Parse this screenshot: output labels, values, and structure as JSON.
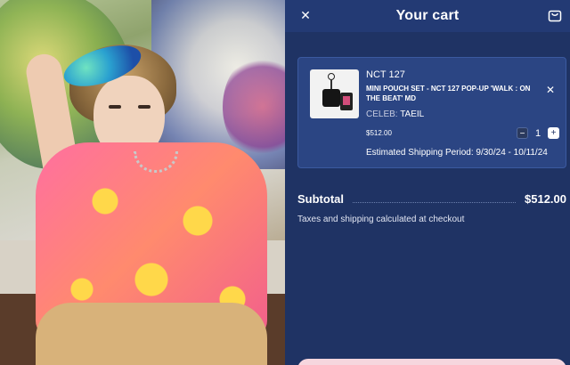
{
  "cart": {
    "title": "Your cart",
    "close_icon": "close-icon",
    "bag_icon": "shopping-bag-icon",
    "items": [
      {
        "group": "NCT 127",
        "name": "MINI POUCH SET - NCT 127 POP-UP 'WALK : ON THE BEAT' MD",
        "option_label": "CELEB:",
        "option_value": "TAEIL",
        "price": "$512.00",
        "quantity": "1",
        "shipping": "Estimated Shipping Period: 9/30/24 - 10/11/24"
      }
    ],
    "subtotal_label": "Subtotal",
    "subtotal_amount": "$512.00",
    "tax_note": "Taxes and shipping calculated at checkout"
  },
  "colors": {
    "panel_bg": "#1f3364",
    "card_bg": "#2b4583",
    "checkout_bg": "#f6d6de"
  }
}
